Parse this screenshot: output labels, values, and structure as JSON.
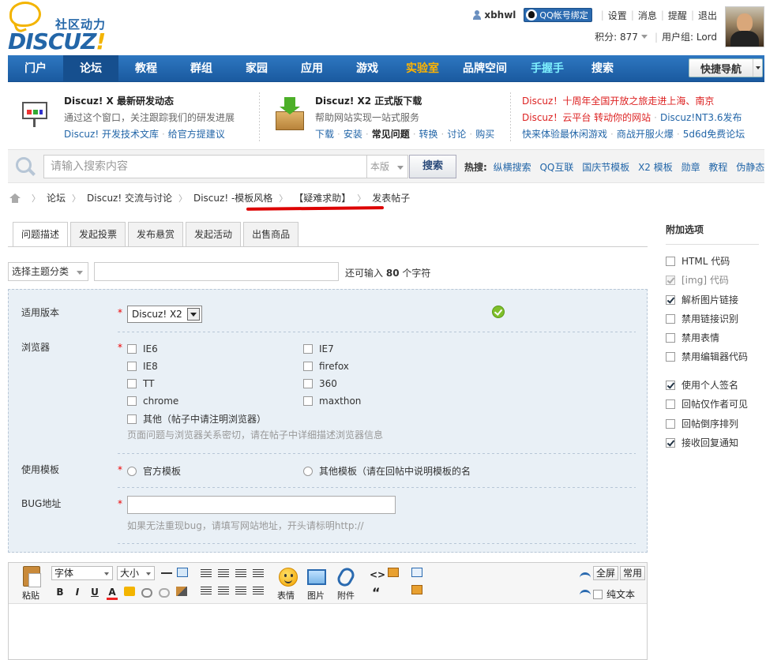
{
  "brand": {
    "slogan": "社区动力",
    "name": "DISCUZ",
    "mark": "!"
  },
  "user": {
    "name": "xbhwl",
    "qq_bind": "QQ帐号绑定",
    "links": [
      "设置",
      "消息",
      "提醒",
      "退出"
    ],
    "score_label": "积分: 877",
    "group_label": "用户组: Lord"
  },
  "nav": {
    "items": [
      "门户",
      "论坛",
      "教程",
      "群组",
      "家园",
      "应用",
      "游戏",
      "实验室",
      "品牌空间",
      "手握手",
      "搜索"
    ],
    "active_index": 1,
    "quick": "快捷导航"
  },
  "info": {
    "block1": {
      "title": "Discuz! X 最新研发动态",
      "desc": "通过这个窗口，关注跟踪我们的研发进展",
      "links": [
        "Discuz! 开发技术文库",
        "给官方提建议"
      ]
    },
    "block2": {
      "title": "Discuz! X2 正式版下载",
      "desc": "帮助网站实现一站式服务",
      "links": [
        "下载",
        "安装",
        "常见问题",
        "转换",
        "讨论",
        "购买"
      ]
    },
    "block3": {
      "line1": "Discuz！十周年全国开放之旅走进上海、南京",
      "line2a": "Discuz！云平台 转动你的网站",
      "line2b": "Discuz!NT3.6发布",
      "line3a": "快来体验最休闲游戏",
      "line3b": "商战开服火爆",
      "line3c": "5d6d免费论坛"
    }
  },
  "search": {
    "placeholder": "请输入搜索内容",
    "scope": "本版",
    "button": "搜索",
    "hot_label": "热搜:",
    "hot": [
      "纵横搜索",
      "QQ互联",
      "国庆节模板",
      "X2 模板",
      "勋章",
      "教程",
      "伪静态"
    ]
  },
  "breadcrumb": [
    "论坛",
    "Discuz! 交流与讨论",
    "Discuz! -模板风格",
    "【疑难求助】",
    "发表帖子"
  ],
  "tabs": [
    "问题描述",
    "发起投票",
    "发布悬赏",
    "发起活动",
    "出售商品"
  ],
  "subject": {
    "type_select": "选择主题分类",
    "remain_prefix": "还可输入",
    "remain_count": "80",
    "remain_suffix": "个字符"
  },
  "form": {
    "version": {
      "label": "适用版本",
      "value": "Discuz! X2"
    },
    "browser": {
      "label": "浏览器",
      "options": [
        "IE6",
        "IE7",
        "IE8",
        "firefox",
        "TT",
        "360",
        "chrome",
        "maxthon",
        "其他（帖子中请注明浏览器）"
      ],
      "hint": "页面问题与浏览器关系密切，请在帖子中详细描述浏览器信息"
    },
    "template": {
      "label": "使用模板",
      "options": [
        "官方模板",
        "其他模板（请在回帖中说明模板的名"
      ]
    },
    "bug": {
      "label": "BUG地址",
      "hint": "如果无法重现bug，请填写网站地址，开头请标明http://"
    },
    "star": "*"
  },
  "editor": {
    "paste": "粘贴",
    "font": "字体",
    "size": "大小",
    "format": [
      "B",
      "I",
      "U",
      "A"
    ],
    "smiley": "表情",
    "image": "图片",
    "attach": "附件",
    "code": "<>",
    "quote": "“",
    "fullscreen": "全屏",
    "common": "常用",
    "plaintext": "纯文本"
  },
  "sidebar": {
    "title": "附加选项",
    "options": [
      {
        "label": "HTML 代码",
        "checked": false,
        "disabled": false
      },
      {
        "label": "[img] 代码",
        "checked": true,
        "disabled": true
      },
      {
        "label": "解析图片链接",
        "checked": true,
        "disabled": false
      },
      {
        "label": "禁用链接识别",
        "checked": false,
        "disabled": false
      },
      {
        "label": "禁用表情",
        "checked": false,
        "disabled": false
      },
      {
        "label": "禁用编辑器代码",
        "checked": false,
        "disabled": false
      },
      {
        "label": "使用个人签名",
        "checked": true,
        "disabled": false
      },
      {
        "label": "回帖仅作者可见",
        "checked": false,
        "disabled": false
      },
      {
        "label": "回帖倒序排列",
        "checked": false,
        "disabled": false
      },
      {
        "label": "接收回复通知",
        "checked": true,
        "disabled": false
      }
    ]
  },
  "colors": {
    "nav_blue": "#1a5aa0",
    "brand_blue": "#2366a8",
    "accent_orange": "#ffb400",
    "annotation_red": "#dd0000"
  }
}
